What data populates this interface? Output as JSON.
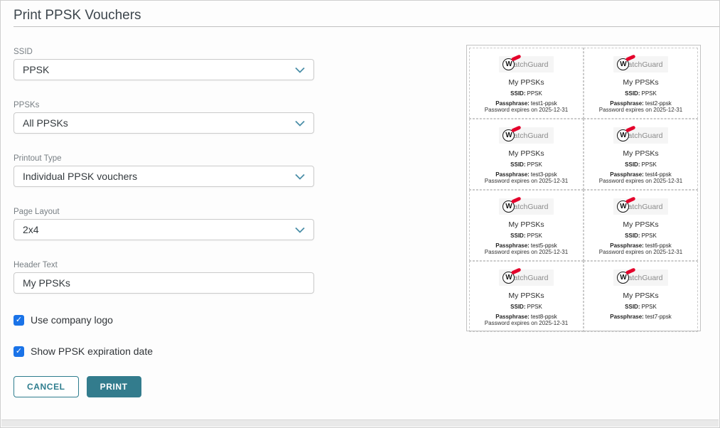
{
  "window": {
    "title": "Print PPSK Vouchers"
  },
  "form": {
    "fields": [
      {
        "label": "SSID",
        "value": "PPSK",
        "type": "select"
      },
      {
        "label": "PPSKs",
        "value": "All PPSKs",
        "type": "select"
      },
      {
        "label": "Printout Type",
        "value": "Individual PPSK vouchers",
        "type": "select"
      },
      {
        "label": "Page Layout",
        "value": "2x4",
        "type": "select"
      },
      {
        "label": "Header Text",
        "value": "My PPSKs",
        "type": "text"
      }
    ],
    "checkboxes": [
      {
        "label": "Use company logo",
        "checked": true
      },
      {
        "label": "Show PPSK expiration date",
        "checked": true
      }
    ],
    "buttons": {
      "cancel": "CANCEL",
      "print": "PRINT"
    }
  },
  "preview": {
    "layout": "2x4",
    "logo": {
      "letter": "W",
      "rest": "atchGuard"
    },
    "labels": {
      "ssid": "SSID:",
      "passphrase": "Passphrase:"
    },
    "vouchers": [
      {
        "header": "My PPSKs",
        "ssid": "PPSK",
        "passphrase": "test1-ppsk",
        "expiry": "Password expires on 2025-12-31"
      },
      {
        "header": "My PPSKs",
        "ssid": "PPSK",
        "passphrase": "test2-ppsk",
        "expiry": "Password expires on 2025-12-31"
      },
      {
        "header": "My PPSKs",
        "ssid": "PPSK",
        "passphrase": "test3-ppsk",
        "expiry": "Password expires on 2025-12-31"
      },
      {
        "header": "My PPSKs",
        "ssid": "PPSK",
        "passphrase": "test4-ppsk",
        "expiry": "Password expires on 2025-12-31"
      },
      {
        "header": "My PPSKs",
        "ssid": "PPSK",
        "passphrase": "test5-ppsk",
        "expiry": "Password expires on 2025-12-31"
      },
      {
        "header": "My PPSKs",
        "ssid": "PPSK",
        "passphrase": "test6-ppsk",
        "expiry": "Password expires on 2025-12-31"
      },
      {
        "header": "My PPSKs",
        "ssid": "PPSK",
        "passphrase": "test8-ppsk",
        "expiry": "Password expires on 2025-12-31"
      },
      {
        "header": "My PPSKs",
        "ssid": "PPSK",
        "passphrase": "test7-ppsk",
        "expiry": ""
      }
    ]
  },
  "colors": {
    "accent_teal": "#337c8d",
    "checkbox_blue": "#1a73e8",
    "logo_red": "#e4002b"
  }
}
